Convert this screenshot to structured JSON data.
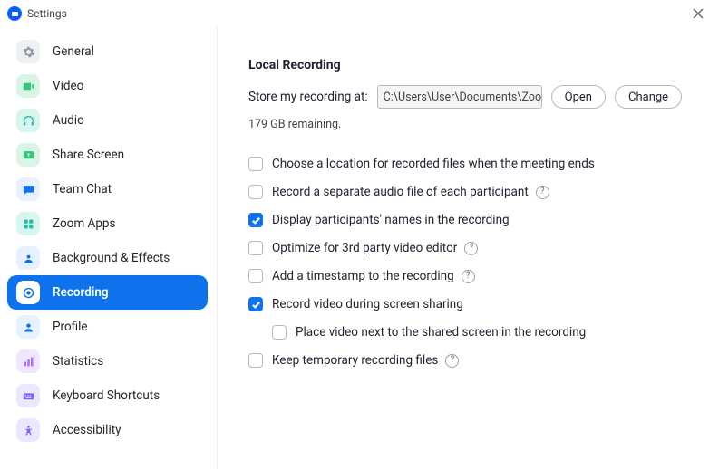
{
  "titlebar": {
    "title": "Settings"
  },
  "sidebar": {
    "items": [
      {
        "label": "General"
      },
      {
        "label": "Video"
      },
      {
        "label": "Audio"
      },
      {
        "label": "Share Screen"
      },
      {
        "label": "Team Chat"
      },
      {
        "label": "Zoom Apps"
      },
      {
        "label": "Background & Effects"
      },
      {
        "label": "Recording"
      },
      {
        "label": "Profile"
      },
      {
        "label": "Statistics"
      },
      {
        "label": "Keyboard Shortcuts"
      },
      {
        "label": "Accessibility"
      }
    ],
    "active_index": 7
  },
  "main": {
    "section_title": "Local Recording",
    "store_label": "Store my recording at:",
    "store_path": "C:\\Users\\User\\Documents\\Zoom",
    "open_button": "Open",
    "change_button": "Change",
    "storage_remaining": "179 GB remaining.",
    "options": [
      {
        "label": "Choose a location for recorded files when the meeting ends",
        "checked": false,
        "help": false,
        "indent": false
      },
      {
        "label": "Record a separate audio file of each participant",
        "checked": false,
        "help": true,
        "indent": false
      },
      {
        "label": "Display participants' names in the recording",
        "checked": true,
        "help": false,
        "indent": false
      },
      {
        "label": "Optimize for 3rd party video editor",
        "checked": false,
        "help": true,
        "indent": false
      },
      {
        "label": "Add a timestamp to the recording",
        "checked": false,
        "help": true,
        "indent": false
      },
      {
        "label": "Record video during screen sharing",
        "checked": true,
        "help": false,
        "indent": false
      },
      {
        "label": "Place video next to the shared screen in the recording",
        "checked": false,
        "help": false,
        "indent": true
      },
      {
        "label": "Keep temporary recording files",
        "checked": false,
        "help": true,
        "indent": false
      }
    ]
  }
}
